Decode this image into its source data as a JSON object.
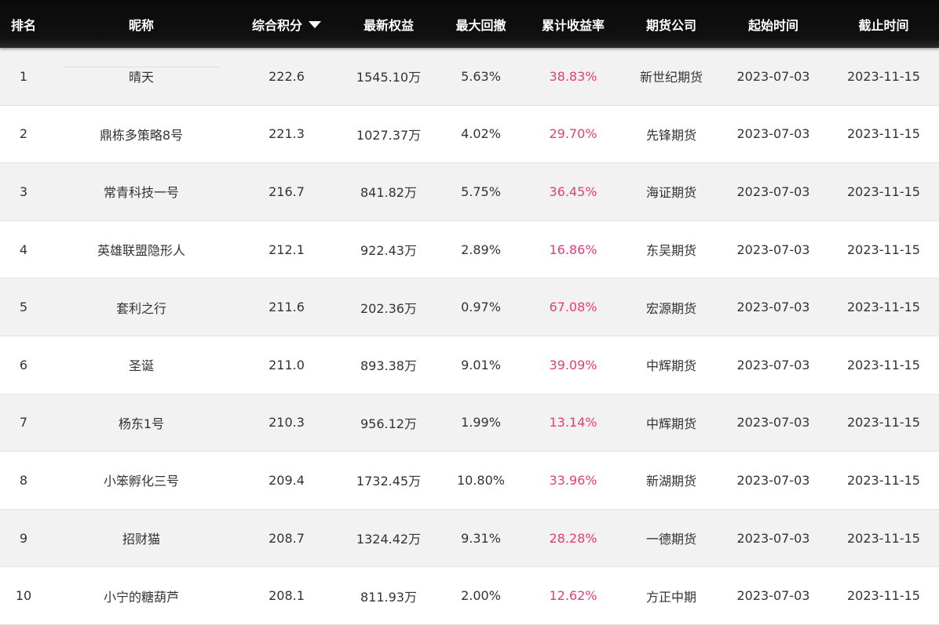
{
  "header": {
    "rank": "排名",
    "name": "昵称",
    "score": "综合积分",
    "equity": "最新权益",
    "drawdown": "最大回撤",
    "rate": "累计收益率",
    "company": "期货公司",
    "start": "起始时间",
    "end": "截止时间",
    "sort_icon": "caret-down-icon"
  },
  "colors": {
    "header_bg": "#111111",
    "header_text": "#ffffff",
    "rate_text": "#e83c78",
    "row_alt_bg": "#f2f2f2"
  },
  "rows": [
    {
      "rank": "1",
      "name": "晴天",
      "score": "222.6",
      "equity": "1545.10万",
      "drawdown": "5.63%",
      "rate": "38.83%",
      "company": "新世纪期货",
      "start": "2023-07-03",
      "end": "2023-11-15"
    },
    {
      "rank": "2",
      "name": "鼎栋多策略8号",
      "score": "221.3",
      "equity": "1027.37万",
      "drawdown": "4.02%",
      "rate": "29.70%",
      "company": "先锋期货",
      "start": "2023-07-03",
      "end": "2023-11-15"
    },
    {
      "rank": "3",
      "name": "常青科技一号",
      "score": "216.7",
      "equity": "841.82万",
      "drawdown": "5.75%",
      "rate": "36.45%",
      "company": "海证期货",
      "start": "2023-07-03",
      "end": "2023-11-15"
    },
    {
      "rank": "4",
      "name": "英雄联盟隐形人",
      "score": "212.1",
      "equity": "922.43万",
      "drawdown": "2.89%",
      "rate": "16.86%",
      "company": "东吴期货",
      "start": "2023-07-03",
      "end": "2023-11-15"
    },
    {
      "rank": "5",
      "name": "套利之行",
      "score": "211.6",
      "equity": "202.36万",
      "drawdown": "0.97%",
      "rate": "67.08%",
      "company": "宏源期货",
      "start": "2023-07-03",
      "end": "2023-11-15"
    },
    {
      "rank": "6",
      "name": "圣诞",
      "score": "211.0",
      "equity": "893.38万",
      "drawdown": "9.01%",
      "rate": "39.09%",
      "company": "中辉期货",
      "start": "2023-07-03",
      "end": "2023-11-15"
    },
    {
      "rank": "7",
      "name": "杨东1号",
      "score": "210.3",
      "equity": "956.12万",
      "drawdown": "1.99%",
      "rate": "13.14%",
      "company": "中辉期货",
      "start": "2023-07-03",
      "end": "2023-11-15"
    },
    {
      "rank": "8",
      "name": "小笨孵化三号",
      "score": "209.4",
      "equity": "1732.45万",
      "drawdown": "10.80%",
      "rate": "33.96%",
      "company": "新湖期货",
      "start": "2023-07-03",
      "end": "2023-11-15"
    },
    {
      "rank": "9",
      "name": "招财猫",
      "score": "208.7",
      "equity": "1324.42万",
      "drawdown": "9.31%",
      "rate": "28.28%",
      "company": "一德期货",
      "start": "2023-07-03",
      "end": "2023-11-15"
    },
    {
      "rank": "10",
      "name": "小宁的糖葫芦",
      "score": "208.1",
      "equity": "811.93万",
      "drawdown": "2.00%",
      "rate": "12.62%",
      "company": "方正中期",
      "start": "2023-07-03",
      "end": "2023-11-15"
    }
  ]
}
